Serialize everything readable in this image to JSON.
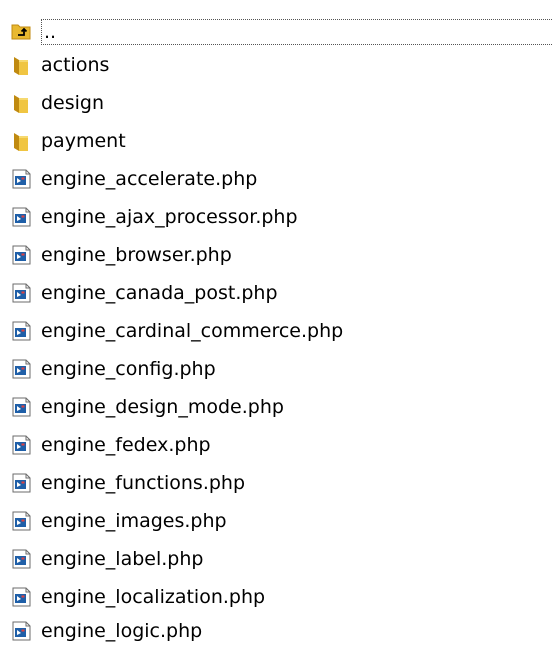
{
  "parent": {
    "label": "..",
    "icon": "folder-up-icon"
  },
  "folders": [
    {
      "label": "actions",
      "icon": "folder-icon"
    },
    {
      "label": "design",
      "icon": "folder-icon"
    },
    {
      "label": "payment",
      "icon": "folder-icon"
    }
  ],
  "files": [
    {
      "label": "engine_accelerate.php",
      "icon": "php-file-icon"
    },
    {
      "label": "engine_ajax_processor.php",
      "icon": "php-file-icon"
    },
    {
      "label": "engine_browser.php",
      "icon": "php-file-icon"
    },
    {
      "label": "engine_canada_post.php",
      "icon": "php-file-icon"
    },
    {
      "label": "engine_cardinal_commerce.php",
      "icon": "php-file-icon"
    },
    {
      "label": "engine_config.php",
      "icon": "php-file-icon"
    },
    {
      "label": "engine_design_mode.php",
      "icon": "php-file-icon"
    },
    {
      "label": "engine_fedex.php",
      "icon": "php-file-icon"
    },
    {
      "label": "engine_functions.php",
      "icon": "php-file-icon"
    },
    {
      "label": "engine_images.php",
      "icon": "php-file-icon"
    },
    {
      "label": "engine_label.php",
      "icon": "php-file-icon"
    },
    {
      "label": "engine_localization.php",
      "icon": "php-file-icon"
    },
    {
      "label": "engine_logic.php",
      "icon": "php-file-icon"
    }
  ],
  "colors": {
    "folder": "#e8b830",
    "folder_dark": "#c08a10",
    "file_accent": "#1f5fa8"
  }
}
